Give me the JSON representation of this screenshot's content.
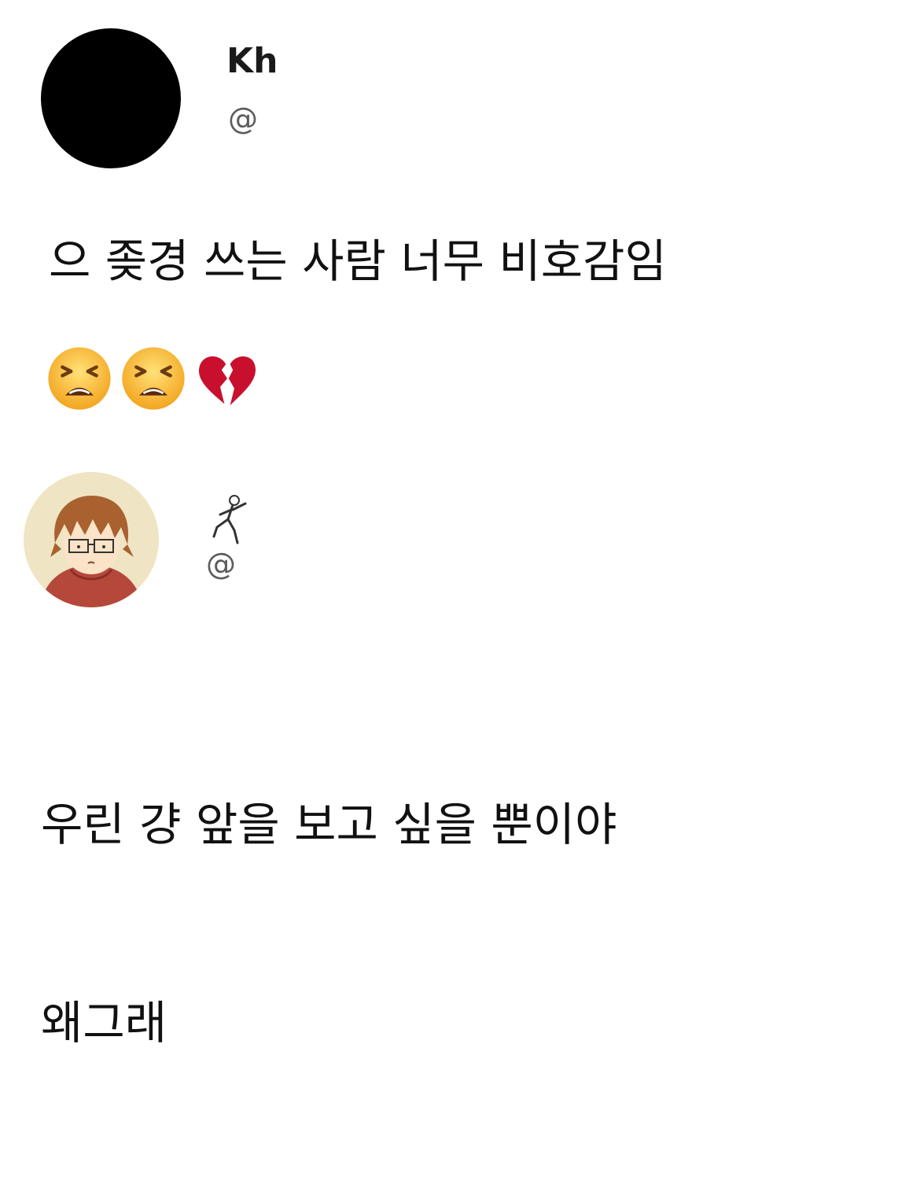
{
  "post": {
    "author_name": "Kh",
    "author_handle": "@",
    "text": "으 좆경 쓰는 사람 너무 비호감임",
    "emojis": [
      "tired-face-emoji",
      "tired-face-emoji",
      "broken-heart-emoji"
    ]
  },
  "reply": {
    "author_handle": "@",
    "name_icon": "running-figure-icon",
    "text_lines": [
      "우린 걍 앞을 보고 싶을 뿐이야",
      "왜그래"
    ]
  },
  "colors": {
    "text": "#111111",
    "handle": "#5c5c5c",
    "background": "#ffffff"
  }
}
